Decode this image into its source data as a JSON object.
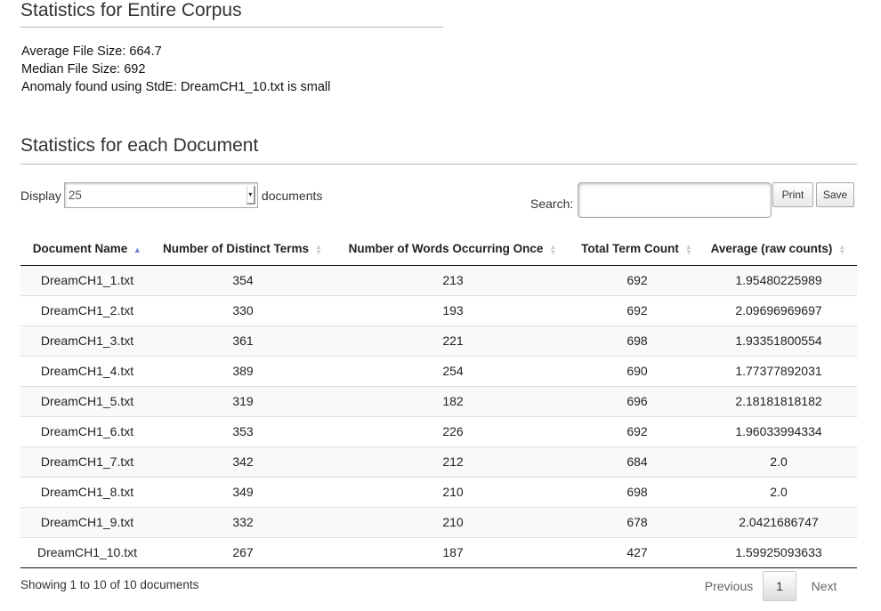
{
  "corpus": {
    "heading": "Statistics for Entire Corpus",
    "avg_label": "Average File Size: 664.7",
    "median_label": "Median File Size: 692",
    "anomaly_label": "Anomaly found using StdE: DreamCH1_10.txt is small"
  },
  "documents": {
    "heading": "Statistics for each Document",
    "display_label": "Display",
    "display_value": "25",
    "documents_label": "documents",
    "search_label": "Search:",
    "search_value": "",
    "print_label": "Print",
    "save_label": "Save"
  },
  "table": {
    "columns": [
      "Document Name",
      "Number of Distinct Terms",
      "Number of Words Occurring Once",
      "Total Term Count",
      "Average (raw counts)"
    ],
    "sorted_column": "Document Name",
    "sort_direction": "ascending",
    "rows": [
      [
        "DreamCH1_1.txt",
        "354",
        "213",
        "692",
        "1.95480225989"
      ],
      [
        "DreamCH1_2.txt",
        "330",
        "193",
        "692",
        "2.09696969697"
      ],
      [
        "DreamCH1_3.txt",
        "361",
        "221",
        "698",
        "1.93351800554"
      ],
      [
        "DreamCH1_4.txt",
        "389",
        "254",
        "690",
        "1.77377892031"
      ],
      [
        "DreamCH1_5.txt",
        "319",
        "182",
        "696",
        "2.18181818182"
      ],
      [
        "DreamCH1_6.txt",
        "353",
        "226",
        "692",
        "1.96033994334"
      ],
      [
        "DreamCH1_7.txt",
        "342",
        "212",
        "684",
        "2.0"
      ],
      [
        "DreamCH1_8.txt",
        "349",
        "210",
        "698",
        "2.0"
      ],
      [
        "DreamCH1_9.txt",
        "332",
        "210",
        "678",
        "2.0421686747"
      ],
      [
        "DreamCH1_10.txt",
        "267",
        "187",
        "427",
        "1.59925093633"
      ]
    ]
  },
  "footer": {
    "info": "Showing 1 to 10 of 10 documents",
    "previous_label": "Previous",
    "page_label": "1",
    "next_label": "Next"
  },
  "icons": {
    "sort_asc": "triangle-up-icon",
    "sort_both": "sort-arrows-icon",
    "dropdown": "dropdown-arrow-icon"
  },
  "colors": {
    "sort_active": "#6b7fd6",
    "row_stripe": "#f9f9f9"
  }
}
